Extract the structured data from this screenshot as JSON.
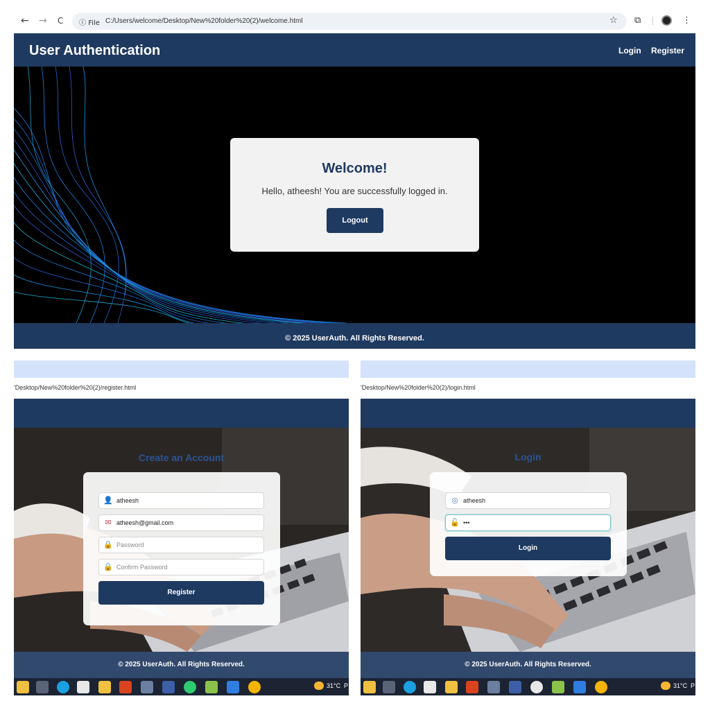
{
  "browser": {
    "back_icon": "←",
    "forward_icon": "→",
    "reload_icon": "C",
    "site_info": "File",
    "url": "C:/Users/welcome/Desktop/New%20folder%20(2)/welcome.html",
    "star_icon": "☆",
    "extensions_icon": "⧉",
    "menu_icon": "⋮"
  },
  "app": {
    "brand": "User Authentication",
    "nav": {
      "login": "Login",
      "register": "Register"
    },
    "footer": "© 2025 UserAuth. All Rights Reserved."
  },
  "welcome": {
    "title": "Welcome!",
    "message": "Hello, atheesh! You are successfully logged in.",
    "logout_label": "Logout"
  },
  "register": {
    "url": "'Desktop/New%20folder%20(2)/register.html",
    "title": "Create an Account",
    "username_value": "atheesh",
    "email_value": "atheesh@gmail.com",
    "password_placeholder": "Password",
    "confirm_placeholder": "Confirm Password",
    "submit_label": "Register"
  },
  "login": {
    "url": "'Desktop/New%20folder%20(2)/login.html",
    "title": "Login",
    "username_value": "atheesh",
    "password_value": "•••",
    "submit_label": "Login"
  },
  "taskbar": {
    "weather": "31°C",
    "weather_cut": "P"
  },
  "colors": {
    "primary": "#1f3a60",
    "accent_title": "#2a5da8"
  }
}
